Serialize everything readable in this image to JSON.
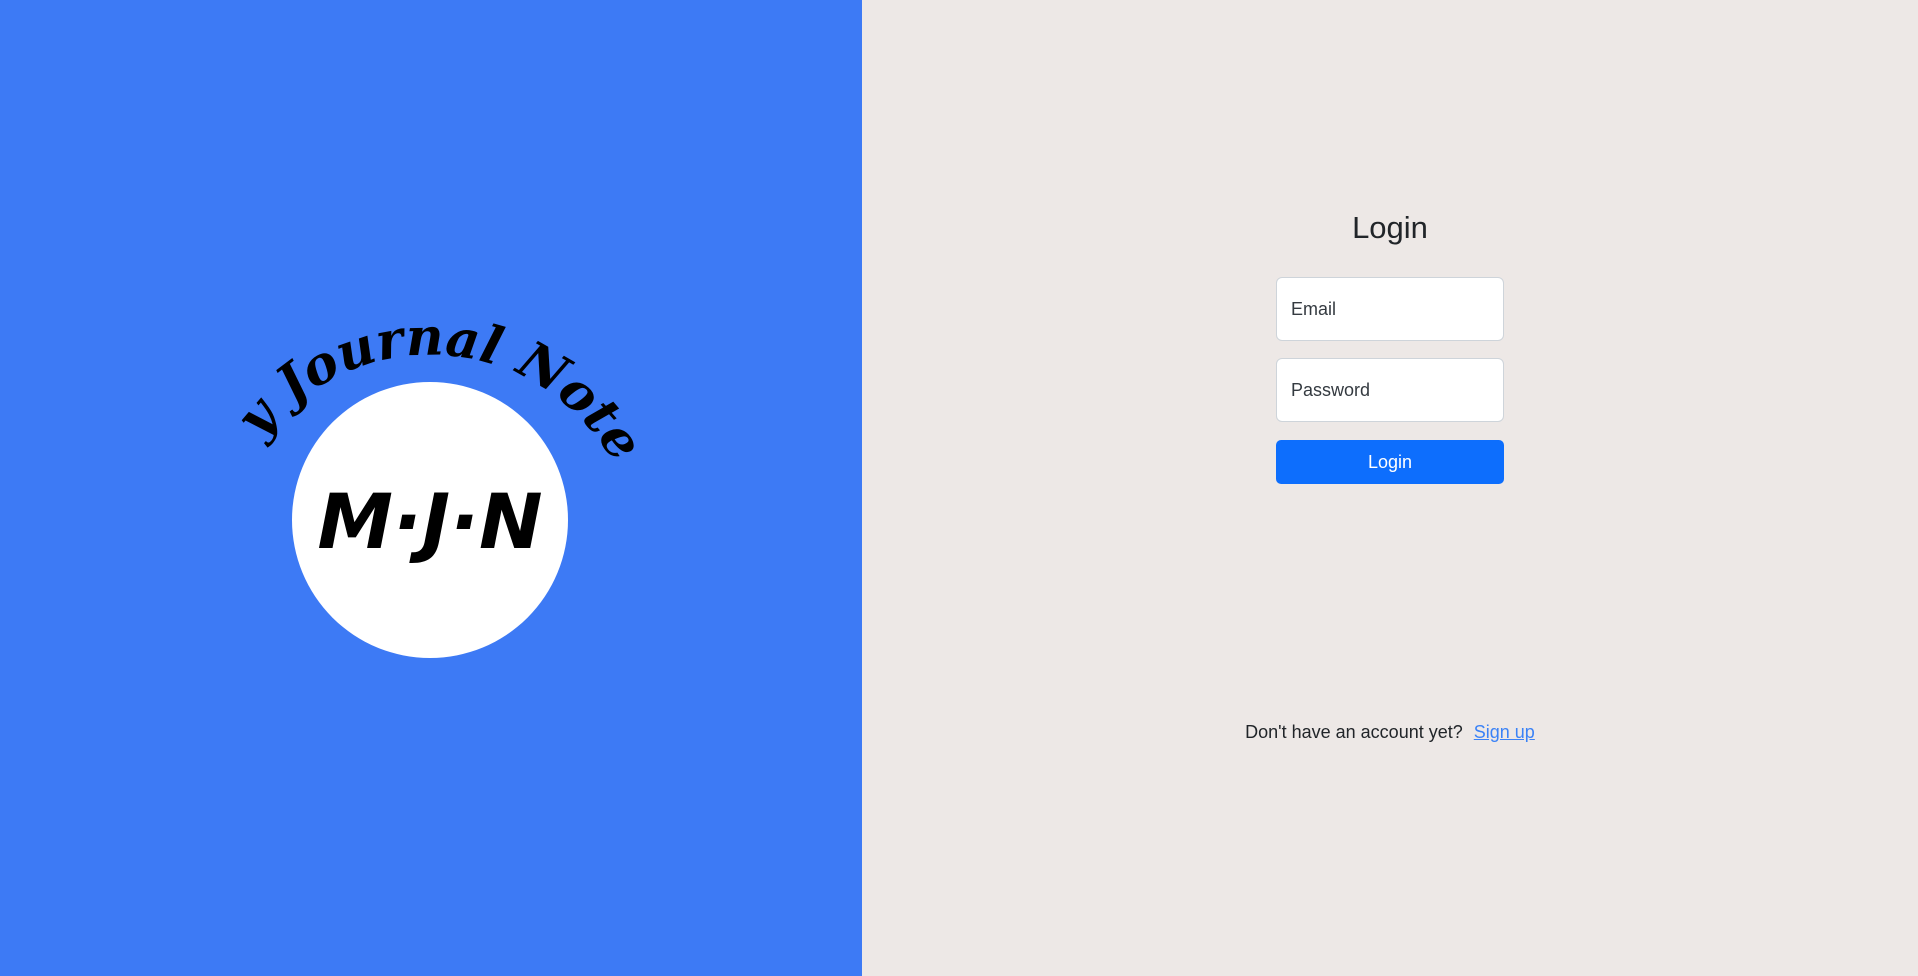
{
  "brand": {
    "arc_text": "My Journal Notes",
    "monogram": "M·J·N"
  },
  "login": {
    "title": "Login",
    "email_placeholder": "Email",
    "password_placeholder": "Password",
    "button_label": "Login",
    "signup_prompt": "Don't have an account yet?",
    "signup_link": "Sign up"
  },
  "colors": {
    "left_panel": "#3d7af5",
    "right_panel": "#ede8e6",
    "primary_button": "#0d6efd",
    "link": "#3b82f6"
  }
}
